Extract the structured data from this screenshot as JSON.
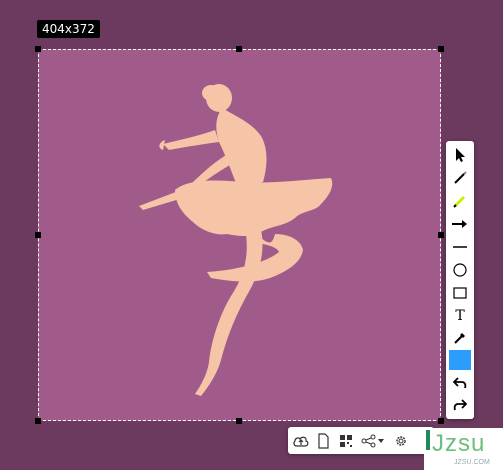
{
  "selection": {
    "size_label": "404x372",
    "background_color": "#a15b8a",
    "figure_color": "#f6c4a7"
  },
  "toolbar_vertical": {
    "tools": [
      {
        "name": "select",
        "icon": "cursor-arrow-icon"
      },
      {
        "name": "pen",
        "icon": "pen-icon"
      },
      {
        "name": "highlighter",
        "icon": "highlighter-icon"
      },
      {
        "name": "arrow",
        "icon": "arrow-right-icon"
      },
      {
        "name": "line",
        "icon": "line-icon"
      },
      {
        "name": "ellipse",
        "icon": "circle-icon"
      },
      {
        "name": "rectangle",
        "icon": "rectangle-icon"
      },
      {
        "name": "text",
        "icon": "text-icon"
      },
      {
        "name": "color-picker",
        "icon": "eyedropper-icon"
      },
      {
        "name": "undo",
        "icon": "undo-icon"
      },
      {
        "name": "redo",
        "icon": "redo-icon"
      }
    ],
    "text_tool_glyph": "T",
    "current_color": "#2a9dff"
  },
  "toolbar_horizontal": {
    "tools": [
      {
        "name": "upload",
        "icon": "cloud-upload-icon"
      },
      {
        "name": "copy",
        "icon": "document-icon"
      },
      {
        "name": "qr-code",
        "icon": "qr-code-icon"
      },
      {
        "name": "share",
        "icon": "share-icon"
      },
      {
        "name": "settings",
        "icon": "gear-icon"
      }
    ]
  },
  "watermark": {
    "text": "Jzsu",
    "subtext": "JZSU.COM"
  }
}
